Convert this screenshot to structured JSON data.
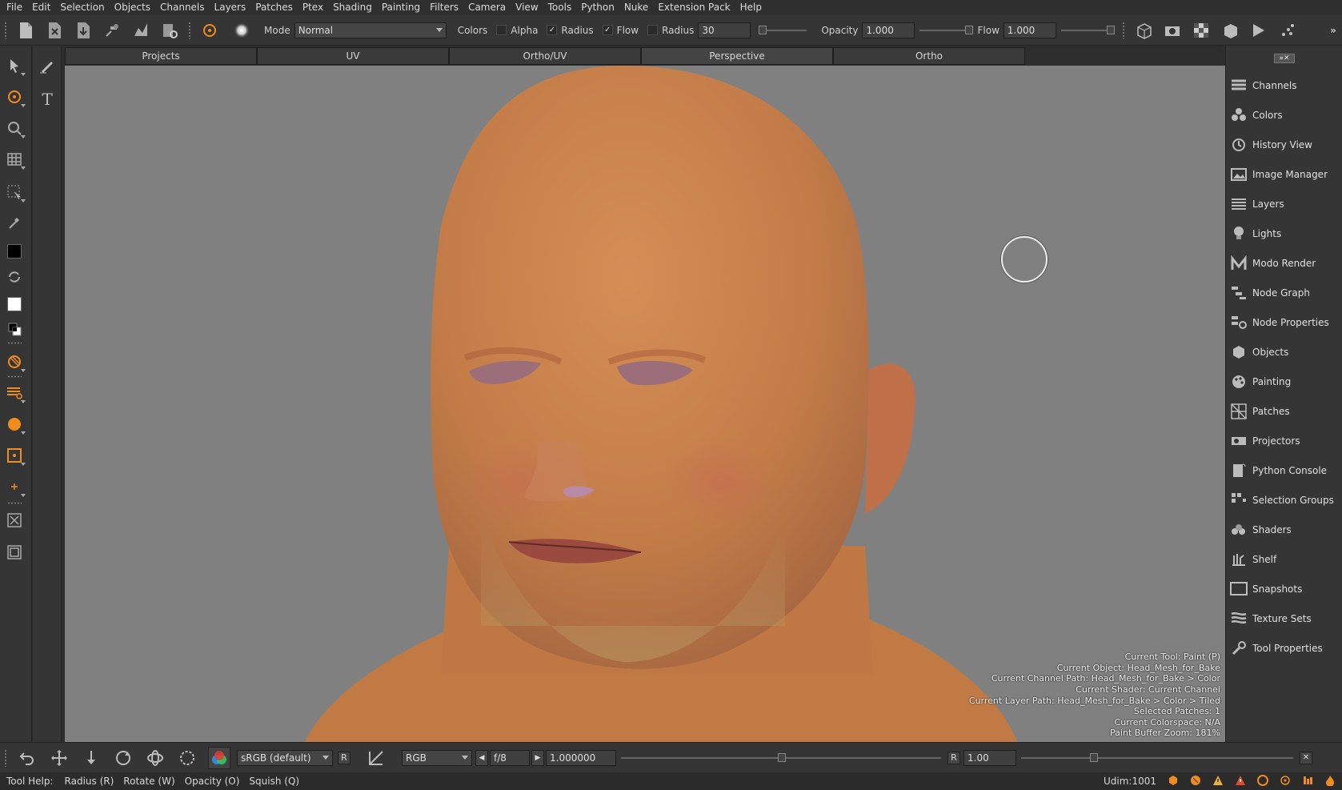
{
  "menubar": {
    "items": [
      {
        "label": "File"
      },
      {
        "label": "Edit"
      },
      {
        "label": "Selection"
      },
      {
        "label": "Objects"
      },
      {
        "label": "Channels"
      },
      {
        "label": "Layers"
      },
      {
        "label": "Patches"
      },
      {
        "label": "Ptex"
      },
      {
        "label": "Shading"
      },
      {
        "label": "Painting"
      },
      {
        "label": "Filters"
      },
      {
        "label": "Camera"
      },
      {
        "label": "View"
      },
      {
        "label": "Tools"
      },
      {
        "label": "Python"
      },
      {
        "label": "Nuke"
      },
      {
        "label": "Extension Pack"
      },
      {
        "label": "Help"
      }
    ]
  },
  "toolbar": {
    "mode_label": "Mode",
    "mode_value": "Normal",
    "colors_label": "Colors",
    "alpha_label": "Alpha",
    "alpha_checked": false,
    "radius_label": "Radius",
    "radius_checked": true,
    "flow_label": "Flow",
    "flow_checked": true,
    "radius2_label": "Radius",
    "radius2_checked": false,
    "radius_value": "30",
    "opacity_label": "Opacity",
    "opacity_value": "1.000",
    "flow2_label": "Flow",
    "flow_value": "1.000",
    "accent_color": "#f08c1e"
  },
  "tabs": [
    {
      "label": "Projects",
      "active": false
    },
    {
      "label": "UV",
      "active": false
    },
    {
      "label": "Ortho/UV",
      "active": false
    },
    {
      "label": "Perspective",
      "active": true
    },
    {
      "label": "Ortho",
      "active": false
    }
  ],
  "hud": {
    "lines": [
      "Current Tool: Paint (P)",
      "Current Object: Head_Mesh_for_Bake",
      "Current Channel Path: Head_Mesh_for_Bake > Color",
      "Current Shader: Current Channel",
      "Current Layer Path: Head_Mesh_for_Bake > Color > Tiled",
      "Selected Patches: 1",
      "Current Colorspace: N/A",
      "Paint Buffer Zoom: 181%"
    ]
  },
  "right_panel": {
    "items": [
      {
        "label": "Channels",
        "icon": "channels-icon"
      },
      {
        "label": "Colors",
        "icon": "colors-icon"
      },
      {
        "label": "History View",
        "icon": "history-icon"
      },
      {
        "label": "Image Manager",
        "icon": "image-manager-icon"
      },
      {
        "label": "Layers",
        "icon": "layers-icon"
      },
      {
        "label": "Lights",
        "icon": "lightbulb-icon"
      },
      {
        "label": "Modo Render",
        "icon": "modo-render-icon"
      },
      {
        "label": "Node Graph",
        "icon": "node-graph-icon"
      },
      {
        "label": "Node Properties",
        "icon": "node-properties-icon"
      },
      {
        "label": "Objects",
        "icon": "objects-icon"
      },
      {
        "label": "Painting",
        "icon": "palette-icon"
      },
      {
        "label": "Patches",
        "icon": "patches-icon"
      },
      {
        "label": "Projectors",
        "icon": "projector-icon"
      },
      {
        "label": "Python Console",
        "icon": "python-console-icon"
      },
      {
        "label": "Selection Groups",
        "icon": "selection-groups-icon"
      },
      {
        "label": "Shaders",
        "icon": "shaders-icon"
      },
      {
        "label": "Shelf",
        "icon": "shelf-icon"
      },
      {
        "label": "Snapshots",
        "icon": "snapshots-icon"
      },
      {
        "label": "Texture Sets",
        "icon": "texture-sets-icon"
      },
      {
        "label": "Tool Properties",
        "icon": "tool-properties-icon"
      }
    ]
  },
  "bottombar": {
    "colorspace_value": "sRGB (default)",
    "r_label": "R",
    "channel_value": "RGB",
    "fstop_value": "f/8",
    "gain_value": "1.000000",
    "r2_label": "R",
    "gamma_value": "1.00"
  },
  "statusbar": {
    "tool_help_label": "Tool Help:",
    "hints": [
      "Radius (R)",
      "Rotate (W)",
      "Opacity (O)",
      "Squish (Q)"
    ],
    "udim": "Udim:1001"
  }
}
